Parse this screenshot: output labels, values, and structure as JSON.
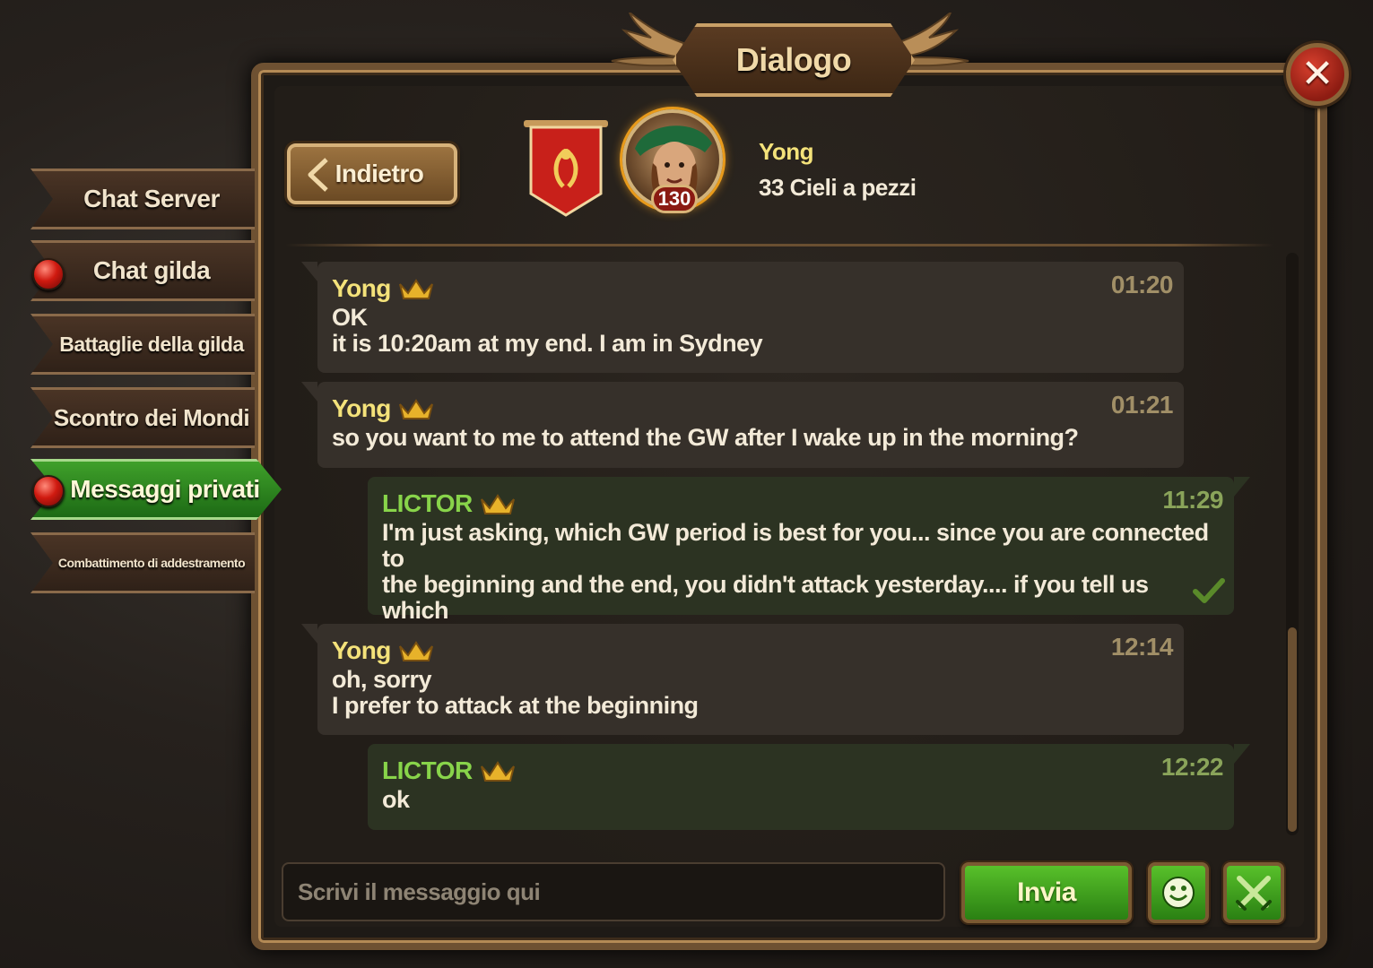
{
  "window": {
    "title": "Dialogo",
    "close_icon": "close-icon"
  },
  "sidebar": {
    "items": [
      {
        "label": "Chat Server",
        "notification": false,
        "active": false
      },
      {
        "label": "Chat gilda",
        "notification": true,
        "active": false
      },
      {
        "label": "Battaglie della gilda",
        "notification": false,
        "active": false
      },
      {
        "label": "Scontro dei Mondi",
        "notification": false,
        "active": false
      },
      {
        "label": "Messaggi privati",
        "notification": true,
        "active": true
      },
      {
        "label": "Combattimento di addestramento",
        "notification": false,
        "active": false
      }
    ]
  },
  "header": {
    "back_label": "Indietro",
    "peer_name": "Yong",
    "peer_guild": "33 Cieli a pezzi",
    "peer_level": "130"
  },
  "messages": [
    {
      "sender": "Yong",
      "side": "them",
      "time": "01:20",
      "text": "OK\nit is 10:20am at my end. I am in Sydney"
    },
    {
      "sender": "Yong",
      "side": "them",
      "time": "01:21",
      "text": "so you want to me to attend the GW after I wake up in the morning?"
    },
    {
      "sender": "LICTOR",
      "side": "me",
      "time": "11:29",
      "text": "I'm just asking, which GW period is best for you... since you are connected to\nthe beginning and the end, you didn't attack yesterday.... if you tell us which\nperiod you prefer, we will accommodate your needs",
      "read": true
    },
    {
      "sender": "Yong",
      "side": "them",
      "time": "12:14",
      "text": "oh, sorry\nI prefer to attack at the beginning"
    },
    {
      "sender": "LICTOR",
      "side": "me",
      "time": "12:22",
      "text": "ok"
    }
  ],
  "composer": {
    "placeholder": "Scrivi il messaggio qui",
    "value": "",
    "send_label": "Invia",
    "emoji_icon": "smiley-icon",
    "extra_icon": "crossed-swords-icon"
  },
  "colors": {
    "frame_gold": "#b48a55",
    "active_tab_green": "#2e8a1e",
    "name_yellow": "#f4e27a",
    "name_green": "#88d44a"
  }
}
